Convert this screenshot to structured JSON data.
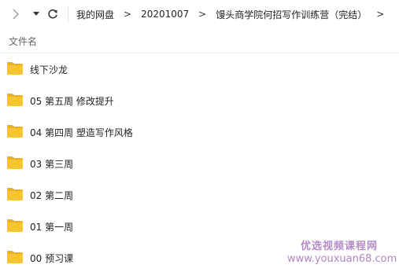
{
  "toolbar": {
    "forward_icon": "chevron-right-icon",
    "dropdown_icon": "caret-down-icon",
    "refresh_icon": "refresh-icon"
  },
  "breadcrumb": {
    "items": [
      "我的网盘",
      "20201007",
      "馒头商学院何招写作训练营（完结）"
    ],
    "separator": ">"
  },
  "columns": {
    "name": "文件名"
  },
  "folders": [
    {
      "name": "线下沙龙"
    },
    {
      "name": "05 第五周 修改提升"
    },
    {
      "name": "04 第四周 塑造写作风格"
    },
    {
      "name": "03 第三周"
    },
    {
      "name": "02 第二周"
    },
    {
      "name": "01 第一周"
    },
    {
      "name": "00 预习课"
    }
  ],
  "watermark": {
    "title": "优选视频课程网",
    "url": "www.youxuan68.com"
  },
  "colors": {
    "folder": "#f7c531",
    "folder_dark": "#eab21e",
    "watermark": "#b58bc7"
  }
}
